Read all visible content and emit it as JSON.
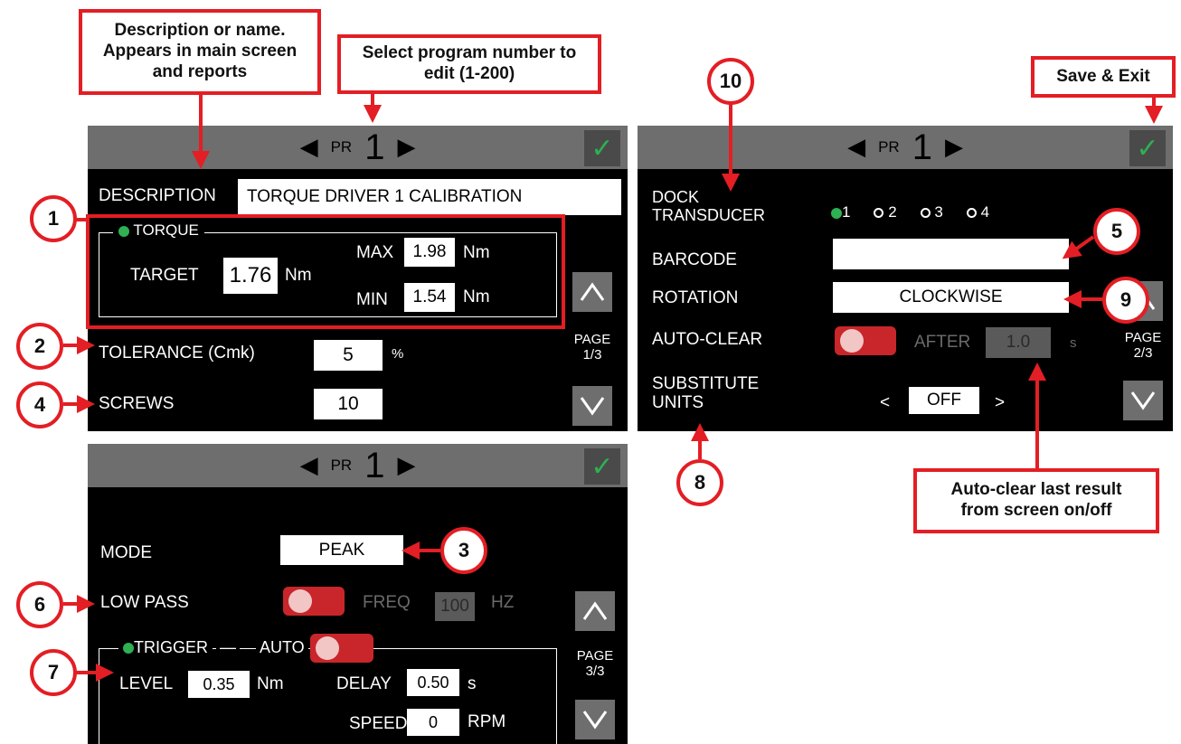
{
  "callouts": {
    "description_note": "Description or name. Appears in main screen and reports",
    "program_note": "Select program number to edit (1-200)",
    "save_note": "Save & Exit",
    "autoclear_note": "Auto-clear last result from screen on/off"
  },
  "badges": [
    "1",
    "2",
    "3",
    "4",
    "5",
    "6",
    "7",
    "8",
    "9",
    "10"
  ],
  "common": {
    "left_arrow": "◀",
    "right_arrow": "▶",
    "pr_label": "PR",
    "pr_number": "1",
    "save_icon": "✓"
  },
  "screen1": {
    "description_label": "DESCRIPTION",
    "description_value": "TORQUE DRIVER 1 CALIBRATION",
    "torque_legend": "TORQUE",
    "target_label": "TARGET",
    "target_value": "1.76",
    "target_unit": "Nm",
    "max_label": "MAX",
    "max_value": "1.98",
    "max_unit": "Nm",
    "min_label": "MIN",
    "min_value": "1.54",
    "min_unit": "Nm",
    "tolerance_label": "TOLERANCE (Cmk)",
    "tolerance_value": "5",
    "tolerance_unit": "%",
    "screws_label": "SCREWS",
    "screws_value": "10",
    "page_label": "PAGE",
    "page_value": "1/3"
  },
  "screen2": {
    "dock_label_1": "DOCK",
    "dock_label_2": "TRANSDUCER",
    "dock_options": [
      "1",
      "2",
      "3",
      "4"
    ],
    "barcode_label": "BARCODE",
    "barcode_value": "",
    "rotation_label": "ROTATION",
    "rotation_value": "CLOCKWISE",
    "autoclear_label": "AUTO-CLEAR",
    "after_label": "AFTER",
    "after_value": "1.0",
    "after_unit": "s",
    "substitute_label_1": "SUBSTITUTE",
    "substitute_label_2": "UNITS",
    "substitute_prev": "<",
    "substitute_value": "OFF",
    "substitute_next": ">",
    "page_label": "PAGE",
    "page_value": "2/3"
  },
  "screen3": {
    "mode_label": "MODE",
    "mode_value": "PEAK",
    "lowpass_label": "LOW PASS",
    "freq_label": "FREQ",
    "freq_value": "100",
    "freq_unit": "HZ",
    "trigger_legend": "TRIGGER",
    "trigger_auto": "AUTO",
    "level_label": "LEVEL",
    "level_value": "0.35",
    "level_unit": "Nm",
    "delay_label": "DELAY",
    "delay_value": "0.50",
    "delay_unit": "s",
    "speed_label": "SPEED",
    "speed_value": "0",
    "speed_unit": "RPM",
    "page_label": "PAGE",
    "page_value": "3/3"
  },
  "colors": {
    "annotation_red": "#e31e24",
    "header_gray": "#6e6e6e",
    "status_green": "#2fb052",
    "toggle_red": "#c8262a"
  },
  "icons": [
    "left-arrow-icon",
    "right-arrow-icon",
    "checkmark-icon",
    "chevron-up-icon",
    "chevron-down-icon",
    "status-dot-icon",
    "radio-icon"
  ]
}
